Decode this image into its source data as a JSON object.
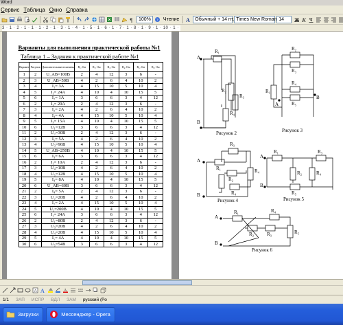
{
  "window": {
    "title": "Word"
  },
  "menu": {
    "items": [
      "Сервис",
      "Таблица",
      "Окно",
      "Справка"
    ]
  },
  "toolbar": {
    "zoom": "100%",
    "read_label": "Чтение",
    "style": "Обычный + 14 пт,",
    "font": "Times New Roman",
    "size": "14"
  },
  "ruler": {
    "marks": "3 · 1 · 2 · 1 · 1 · 1 · 2 · 1 · 3 · 1 · 4 · 1 · 5 · 1 · 6 · 1 · 7 · 1 · 8 · 1 · 9 · 1 · 10 · 1 · 11 · 1 · 12 · 1 · 13"
  },
  "document": {
    "title": "Варианты для выполнения практической работы №1",
    "table_caption": "Таблица 1 – Задания к практической работе №1",
    "table": {
      "headers": [
        "Вариант",
        "Рисунок",
        "Дополнительные величины",
        "R₁, Ом",
        "R₂, Ом",
        "R₃, Ом",
        "R₄, Ом",
        "R₅, Ом",
        "R₆, Ом"
      ],
      "rows": [
        [
          "1",
          "2",
          "U_AB=100В",
          "2",
          "4",
          "12",
          "3",
          "6",
          "-"
        ],
        [
          "2",
          "3",
          "U_AB=50В",
          "4",
          "2",
          "6",
          "4",
          "10",
          "2"
        ],
        [
          "3",
          "4",
          "I₁= 3А",
          "4",
          "15",
          "10",
          "5",
          "10",
          "4"
        ],
        [
          "4",
          "5",
          "I₁= 24А",
          "4",
          "10",
          "4",
          "10",
          "15",
          "5"
        ],
        [
          "5",
          "6",
          "I₂= 1А",
          "3",
          "6",
          "6",
          "3",
          "4",
          "12"
        ],
        [
          "6",
          "2",
          "I₃= 20А",
          "2",
          "4",
          "12",
          "3",
          "6",
          "-"
        ],
        [
          "7",
          "3",
          "I₂= 2А",
          "4",
          "2",
          "6",
          "4",
          "10",
          "2"
        ],
        [
          "8",
          "4",
          "I₄= 4А",
          "4",
          "15",
          "10",
          "5",
          "10",
          "4"
        ],
        [
          "9",
          "5",
          "I₃= 15А",
          "4",
          "10",
          "4",
          "10",
          "15",
          "5"
        ],
        [
          "10",
          "6",
          "U₁=12В",
          "3",
          "6",
          "6",
          "3",
          "4",
          "12"
        ],
        [
          "11",
          "2",
          "U₂=30В",
          "2",
          "4",
          "12",
          "3",
          "6",
          "-"
        ],
        [
          "12",
          "3",
          "I₅= 5А",
          "4",
          "2",
          "6",
          "4",
          "10",
          "2"
        ],
        [
          "13",
          "4",
          "U₃=96В",
          "4",
          "15",
          "10",
          "5",
          "10",
          "4"
        ],
        [
          "14",
          "5",
          "U_AB=250В",
          "4",
          "10",
          "4",
          "10",
          "15",
          "5"
        ],
        [
          "15",
          "6",
          "I₃= 6А",
          "3",
          "6",
          "6",
          "3",
          "4",
          "12"
        ],
        [
          "16",
          "2",
          "I₁= 10А",
          "2",
          "4",
          "12",
          "3",
          "6",
          "-"
        ],
        [
          "17",
          "3",
          "U₄=10В",
          "4",
          "2",
          "6",
          "4",
          "10",
          "2"
        ],
        [
          "18",
          "4",
          "U₅=12В",
          "4",
          "15",
          "10",
          "5",
          "10",
          "4"
        ],
        [
          "19",
          "5",
          "I₄= 8А",
          "4",
          "10",
          "4",
          "10",
          "15",
          "5"
        ],
        [
          "20",
          "6",
          "U_AB=60В",
          "3",
          "6",
          "6",
          "3",
          "4",
          "12"
        ],
        [
          "21",
          "2",
          "I₄= 5А",
          "2",
          "4",
          "12",
          "3",
          "6",
          "-"
        ],
        [
          "22",
          "3",
          "U₂=20В",
          "4",
          "2",
          "6",
          "4",
          "10",
          "2"
        ],
        [
          "23",
          "4",
          "I₂= 2А",
          "4",
          "15",
          "10",
          "5",
          "10",
          "4"
        ],
        [
          "24",
          "5",
          "U₂=200В",
          "4",
          "10",
          "4",
          "10",
          "15",
          "5"
        ],
        [
          "25",
          "6",
          "I₁= 24А",
          "3",
          "6",
          "6",
          "3",
          "4",
          "12"
        ],
        [
          "26",
          "2",
          "U₁=80В",
          "2",
          "4",
          "12",
          "3",
          "6",
          "-"
        ],
        [
          "27",
          "3",
          "U₃=20В",
          "4",
          "2",
          "6",
          "4",
          "10",
          "2"
        ],
        [
          "28",
          "4",
          "U₄=20В",
          "4",
          "15",
          "10",
          "5",
          "10",
          "4"
        ],
        [
          "29",
          "5",
          "I₅= 4А",
          "4",
          "10",
          "4",
          "10",
          "15",
          "5"
        ],
        [
          "30",
          "6",
          "U₅=54В",
          "3",
          "6",
          "6",
          "3",
          "4",
          "12"
        ]
      ]
    },
    "figures": {
      "fig2": "Рисунок 2",
      "fig3": "Рисунок 3",
      "fig4": "Рисунок 4",
      "fig5": "Рисунок 5",
      "fig6": "Рисунок 6"
    },
    "labels": {
      "A": "A",
      "B": "B",
      "R1": "R₁",
      "R2": "R₂",
      "R3": "R₃",
      "R4": "R₄",
      "R5": "R₅"
    }
  },
  "statusbar": {
    "items": [
      "1/1",
      "ЗАП",
      "ИСПР",
      "ВДЛ",
      "ЗАМ",
      "русский (Ро"
    ]
  },
  "taskbar": {
    "items": [
      {
        "label": "Загрузки",
        "active": false
      },
      {
        "label": "Мессенджер - Opera",
        "active": false
      }
    ]
  }
}
